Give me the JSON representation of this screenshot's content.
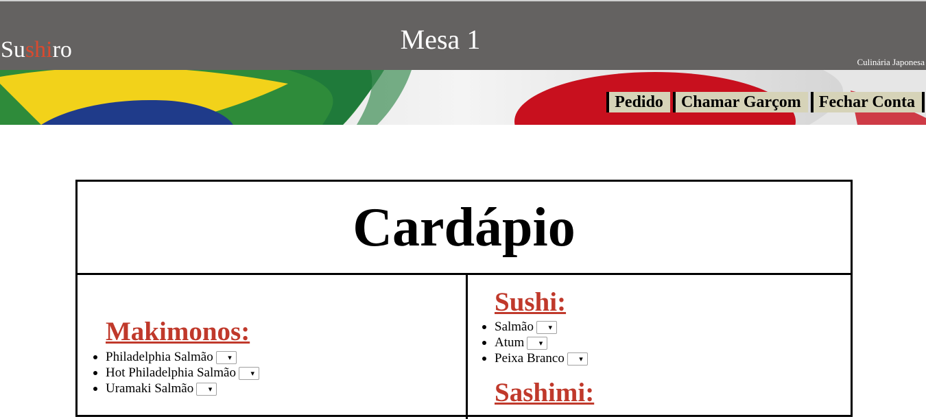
{
  "header": {
    "brand_parts": [
      "Su",
      "shi",
      "ro"
    ],
    "title": "Mesa 1",
    "subtitle": "Culinária Japonesa"
  },
  "nav": {
    "items": [
      "Pedido",
      "Chamar Garçom",
      "Fechar Conta"
    ]
  },
  "menu": {
    "title": "Cardápio",
    "left": {
      "heading": "Makimonos:",
      "items": [
        "Philadelphia Salmão",
        "Hot Philadelphia Salmão",
        "Uramaki Salmão"
      ]
    },
    "right": {
      "heading": "Sushi:",
      "items": [
        "Salmão",
        "Atum",
        "Peixa Branco"
      ],
      "heading2": "Sashimi:"
    }
  },
  "colors": {
    "header_bg": "#646261",
    "accent": "#d94a2f",
    "section_heading": "#c0392b",
    "nav_button_bg": "#d6d3b8"
  }
}
